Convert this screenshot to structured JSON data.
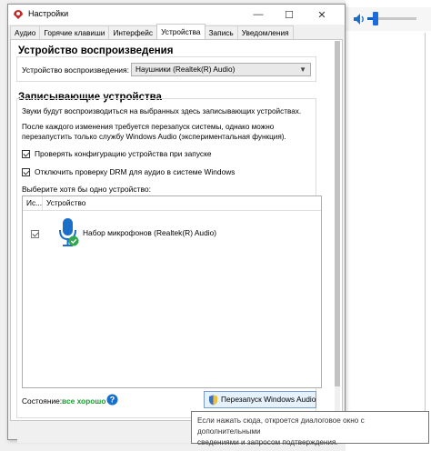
{
  "window": {
    "title": "Настройки",
    "minimize_label": "—",
    "maximize_label": "☐",
    "close_label": "✕"
  },
  "tabs": [
    {
      "label": "Аудио"
    },
    {
      "label": "Горячие клавиши"
    },
    {
      "label": "Интерфейс"
    },
    {
      "label": "Устройства",
      "active": true
    },
    {
      "label": "Запись"
    },
    {
      "label": "Уведомления"
    }
  ],
  "playback": {
    "section_title": "Устройство воспроизведения",
    "device_label": "Устройство воспроизведения:",
    "device_value": "Наушники (Realtek(R) Audio)"
  },
  "recording": {
    "section_title": "Записывающие устройства",
    "desc1": "Звуки будут воспроизводиться на выбранных здесь записывающих устройствах.",
    "desc2_line1": "После каждого изменения требуется перезапуск системы, однако можно",
    "desc2_line2": "перезапустить только службу Windows Audio (экспериментальная функция).",
    "check_config_label": "Проверять конфигурацию устройства при запуске",
    "check_config_checked": true,
    "disable_drm_label": "Отключить проверку DRM для аудио в системе Windows",
    "disable_drm_checked": true,
    "choose_label": "Выберите хотя бы одно устройство:",
    "columns": {
      "col1": "Ис...",
      "col2": "Устройство"
    },
    "devices": [
      {
        "name": "Набор микрофонов (Realtek(R) Audio)",
        "checked": true,
        "icon": "microphone-icon"
      }
    ]
  },
  "status": {
    "label": "Состояние:",
    "value": "все хорошо",
    "value_color": "#1a9e2f"
  },
  "restart_button": {
    "label": "Перезапуск Windows Audio"
  },
  "tooltip": {
    "line1": "Если нажать сюда, откроется диалоговое окно с дополнительными",
    "line2": "сведениями и запросом подтверждения."
  },
  "colors": {
    "accent": "#0b5fd0",
    "icon_blue": "#1a6fc9",
    "ok_green": "#1a9e2f"
  }
}
